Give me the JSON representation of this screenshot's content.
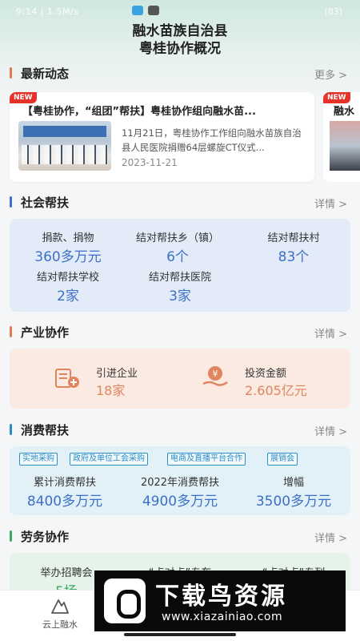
{
  "status_bar": {
    "time": "9:14 | 1.5M/s",
    "right": "(83)"
  },
  "header": {
    "title_line1": "融水苗族自治县",
    "title_line2": "粤桂协作概况"
  },
  "colors": {
    "accent_blue": "#3c70c8",
    "accent_orange": "#e08560",
    "new_tag": "#e5332a"
  },
  "news": {
    "section_title": "最新动态",
    "more_label": "更多 >",
    "items": [
      {
        "tag": "NEW",
        "title": "【粤桂协作，“组团”帮扶】粤桂协作组向融水苗...",
        "desc": "11月21日，粤桂协作工作组向融水苗族自治县人民医院捐赠64层螺旋CT仪式...",
        "date": "2023-11-21"
      },
      {
        "tag": "NEW",
        "title": "融水"
      }
    ]
  },
  "social": {
    "section_title": "社会帮扶",
    "more_label": "详情 >",
    "stats": [
      {
        "label": "捐款、捐物",
        "value": "360多万元"
      },
      {
        "label": "结对帮扶乡（镇）",
        "value": "6个"
      },
      {
        "label": "结对帮扶村",
        "value": "83个"
      },
      {
        "label": "结对帮扶学校",
        "value": "2家"
      },
      {
        "label": "结对帮扶医院",
        "value": "3家"
      }
    ]
  },
  "industry": {
    "section_title": "产业协作",
    "more_label": "详情 >",
    "items": [
      {
        "label": "引进企业",
        "value": "18家",
        "icon": "building-plus-icon"
      },
      {
        "label": "投资金额",
        "value": "2.605亿元",
        "icon": "yen-hand-icon"
      }
    ]
  },
  "consumption": {
    "section_title": "消费帮扶",
    "more_label": "详情 >",
    "tags": [
      "实地采购",
      "政府及单位工会采购",
      "电商及直播平台合作",
      "展销会"
    ],
    "stats": [
      {
        "label": "累计消费帮扶",
        "value": "8400多万元"
      },
      {
        "label": "2022年消费帮扶",
        "value": "4900多万元"
      },
      {
        "label": "增幅",
        "value": "3500多万元"
      }
    ]
  },
  "labor": {
    "section_title": "劳务协作",
    "more_label": "详情 >",
    "stats": [
      {
        "label": "举办招聘会",
        "value": "5场"
      },
      {
        "label": "“点对点”专车",
        "value": ""
      },
      {
        "label": "“点对点”专列",
        "value": ""
      }
    ]
  },
  "bottom_nav": {
    "items": [
      {
        "label": "云上融水",
        "icon": "mountain-home-icon"
      }
    ]
  },
  "watermark": {
    "text": "下载鸟资源",
    "url": "www.xiazainiao.com"
  }
}
